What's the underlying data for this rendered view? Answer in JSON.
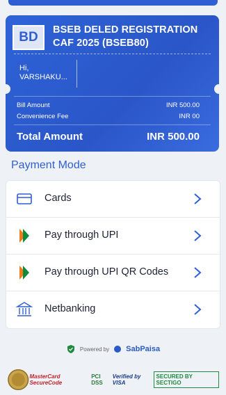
{
  "header": {
    "logo_text": "BD",
    "title": "BSEB DELED REGISTRATION CAF 2025 (BSEB80)"
  },
  "user": {
    "greeting": "Hi,",
    "name": "VARSHAKU..."
  },
  "bill": {
    "bill_amount_label": "Bill Amount",
    "bill_amount_value": "INR 500.00",
    "fee_label": "Convenience Fee",
    "fee_value": "INR 00",
    "total_label": "Total Amount",
    "total_value": "INR 500.00"
  },
  "payment": {
    "title": "Payment Mode",
    "methods": [
      {
        "label": "Cards",
        "icon": "card-icon"
      },
      {
        "label": "Pay through UPI",
        "icon": "upi-icon"
      },
      {
        "label": "Pay through UPI QR Codes",
        "icon": "upi-icon"
      },
      {
        "label": "Netbanking",
        "icon": "bank-icon"
      }
    ]
  },
  "footer": {
    "powered_by": "Powered by",
    "brand": "SabPaisa",
    "badges": [
      "MasterCard SecureCode",
      "PCI DSS",
      "Verified by VISA",
      "SECURED BY SECTIGO"
    ]
  },
  "colors": {
    "primary": "#2f5fd3",
    "accent_upi_orange": "#f27a1a",
    "accent_upi_green": "#0e8a3b"
  }
}
